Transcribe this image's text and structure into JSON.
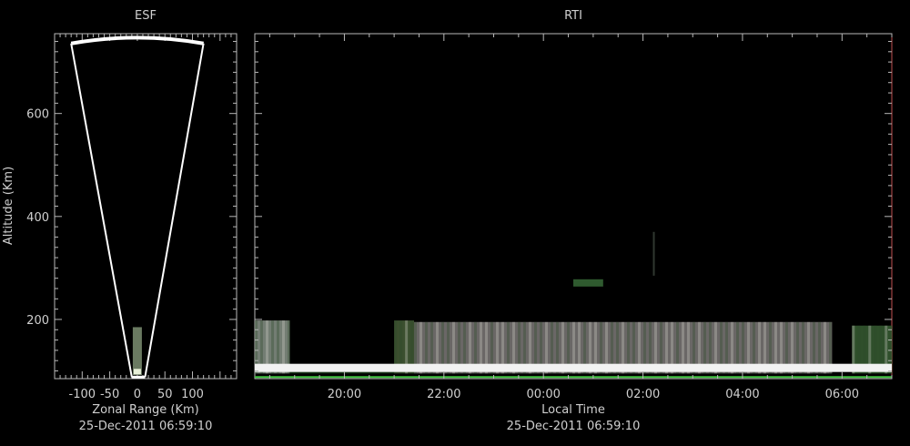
{
  "chart_data": [
    {
      "type": "heatmap",
      "title": "ESF",
      "xlabel": "Zonal Range (Km)",
      "ylabel": "Altitude (Km)",
      "subtitle": "25-Dec-2011 06:59:10",
      "xlim": [
        -150,
        180
      ],
      "ylim": [
        85,
        755
      ],
      "xticks": [
        -100,
        -50,
        0,
        50,
        100
      ],
      "yticks": [
        200,
        400,
        600
      ],
      "xtick_labels": [
        "-100",
        "-50",
        "0",
        "50",
        "100"
      ],
      "ytick_labels": [
        "200",
        "400",
        "600"
      ],
      "fan_max_altitude": 748,
      "fan_edge_range": 120,
      "echo_layer": {
        "range": 0,
        "altitude_top": 185,
        "altitude_bottom": 92
      }
    },
    {
      "type": "heatmap",
      "title": "RTI",
      "xlabel": "Local Time",
      "subtitle": "25-Dec-2011 06:59:10",
      "xlim": [
        18.2,
        31.0
      ],
      "ylim": [
        85,
        755
      ],
      "xticks": [
        20,
        22,
        24,
        26,
        28,
        30
      ],
      "xtick_labels": [
        "20:00",
        "22:00",
        "00:00",
        "02:00",
        "04:00",
        "06:00"
      ],
      "yticks": [
        200,
        400,
        600
      ],
      "echo_blocks": [
        {
          "t_start": 18.2,
          "t_end": 18.9,
          "alt_top": 198,
          "alt_bottom": 95,
          "color": "#9aa79a"
        },
        {
          "t_start": 21.0,
          "t_end": 21.4,
          "alt_top": 198,
          "alt_bottom": 95,
          "color": "#4f6a3f"
        },
        {
          "t_start": 21.4,
          "t_end": 29.8,
          "alt_top": 195,
          "alt_bottom": 95,
          "color": "#8e8a88"
        },
        {
          "t_start": 30.2,
          "t_end": 31.0,
          "alt_top": 188,
          "alt_bottom": 95,
          "color": "#3f6a3a"
        }
      ],
      "bright_layer": {
        "t_start": 18.2,
        "t_end": 31.0,
        "altitude": 105,
        "color": "#f2f2f2"
      },
      "ground_line": {
        "altitude": 88,
        "color": "#3fc23f"
      }
    }
  ]
}
